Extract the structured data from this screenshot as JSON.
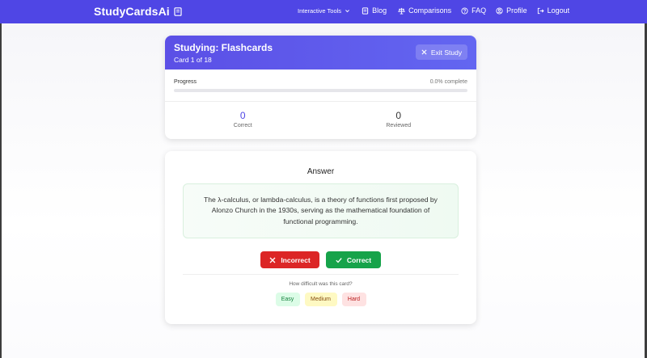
{
  "navbar": {
    "brand": "StudyCardsAi",
    "links": {
      "tools": "Interactive Tools",
      "blog": "Blog",
      "comparisons": "Comparisons",
      "faq": "FAQ",
      "profile": "Profile",
      "logout": "Logout"
    }
  },
  "study": {
    "title": "Studying: Flashcards",
    "card_position": "Card 1 of 18",
    "exit_label": "Exit Study",
    "progress_label": "Progress",
    "progress_text": "0.0% complete",
    "progress_percent": 0,
    "stats": {
      "correct_value": "0",
      "correct_label": "Correct",
      "reviewed_value": "0",
      "reviewed_label": "Reviewed"
    }
  },
  "answer": {
    "title": "Answer",
    "text": "The λ-calculus, or lambda-calculus, is a theory of functions first proposed by Alonzo Church in the 1930s, serving as the mathematical foundation of functional programming.",
    "incorrect_label": "Incorrect",
    "correct_label": "Correct",
    "difficulty_question": "How difficult was this card?",
    "difficulty": {
      "easy": "Easy",
      "medium": "Medium",
      "hard": "Hard"
    }
  },
  "colors": {
    "accent": "#4f46e5",
    "incorrect": "#dc2626",
    "correct": "#16a34a"
  }
}
